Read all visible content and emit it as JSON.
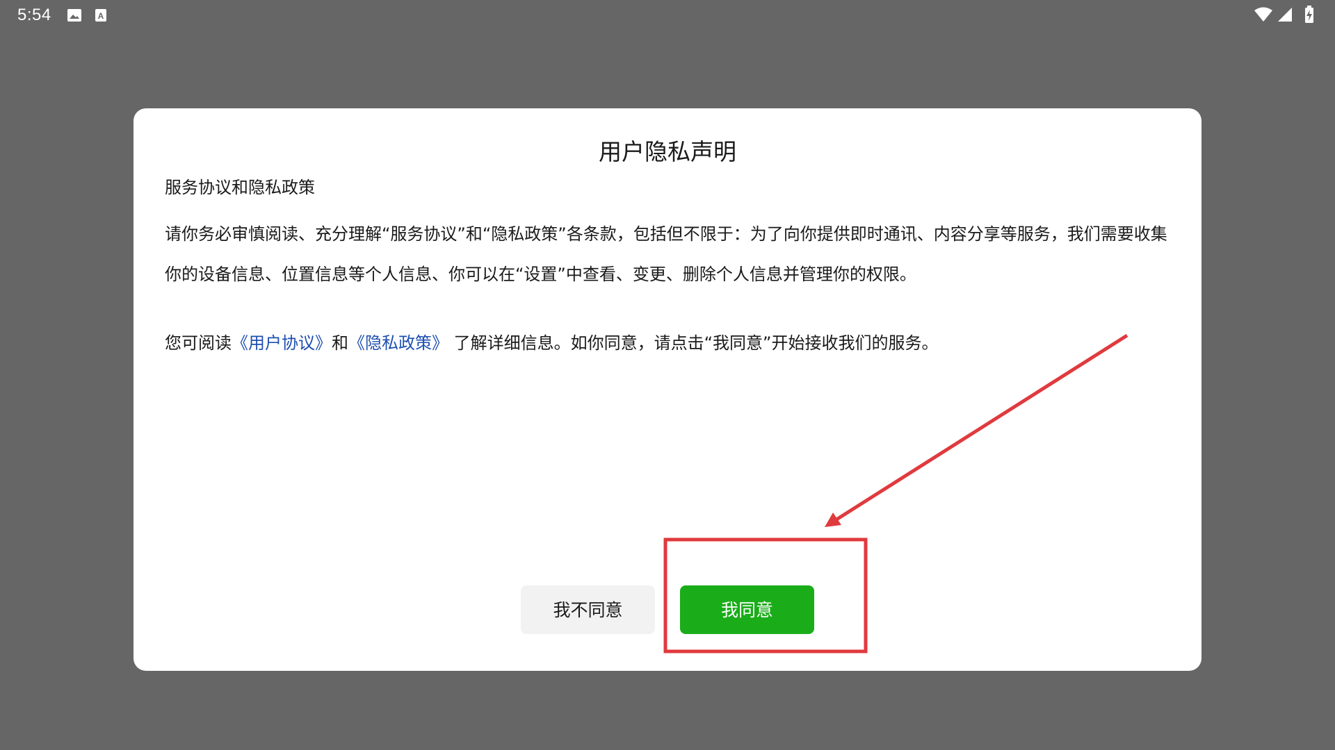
{
  "status_bar": {
    "time": "5:54",
    "left_icons": [
      "image-icon",
      "a-badge-icon"
    ],
    "right_icons": [
      "wifi-icon",
      "signal-icon",
      "battery-charging-icon"
    ]
  },
  "dialog": {
    "title": "用户隐私声明",
    "heading": "服务协议和隐私政策",
    "paragraph": "请你务必审慎阅读、充分理解“服务协议”和“隐私政策”各条款，包括但不限于：为了向你提供即时通讯、内容分享等服务，我们需要收集你的设备信息、位置信息等个人信息、你可以在“设置”中查看、变更、删除个人信息并管理你的权限。",
    "info": {
      "prefix": "您可阅读",
      "user_agreement_link": "《用户协议》",
      "conjunction": "和",
      "privacy_policy_link": "《隐私政策》",
      "suffix": " 了解详细信息。如你同意，请点击“我同意”开始接收我们的服务。"
    },
    "buttons": {
      "disagree": "我不同意",
      "agree": "我同意"
    }
  },
  "colors": {
    "backdrop": "#666666",
    "dialog": "#ffffff",
    "link": "#1e4fb0",
    "agree_button": "#1aad19",
    "disagree_button": "#f2f2f2",
    "annotation": "#e03a3e"
  }
}
